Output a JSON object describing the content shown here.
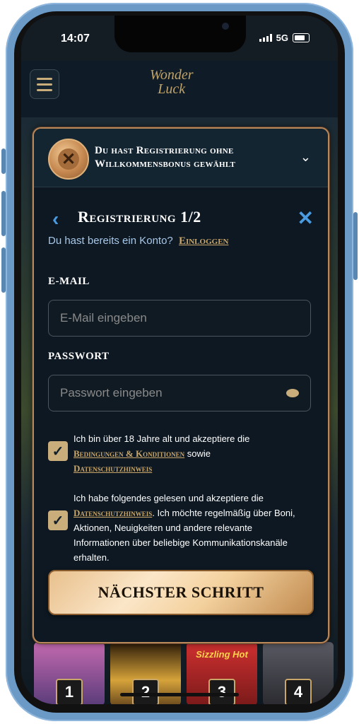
{
  "status_bar": {
    "time": "14:07",
    "network": "5G"
  },
  "site": {
    "logo_line1": "Wonder",
    "logo_line2": "Luck"
  },
  "bonus_banner": {
    "text": "Du hast Registrierung ohne Willkommensbonus gewählt",
    "icon": "x-coin-icon"
  },
  "registration": {
    "title": "Registrierung 1/2",
    "have_account_text": "Du hast bereits ein Konto?",
    "login_link": "Einloggen",
    "email_label": "E-MAIL",
    "email_placeholder": "E-Mail eingeben",
    "password_label": "PASSWORT",
    "password_placeholder": "Passwort eingeben",
    "checkbox1": {
      "checked": true,
      "text_before": "Ich bin über 18 Jahre alt und akzeptiere die",
      "link1": "Bedingungen & Konditionen",
      "text_mid": "sowie",
      "link2": "Datenschutzhinweis"
    },
    "checkbox2": {
      "checked": true,
      "text_before": "Ich habe folgendes gelesen und akzeptiere die",
      "link": "Datenschutzhinweis",
      "text_after": ". Ich möchte regelmäßig über Boni, Aktionen, Neuigkeiten und andere relevante Informationen über beliebige Kommunikationskanäle erhalten."
    },
    "next_button": "NÄCHSTER SCHRITT"
  },
  "games": [
    {
      "num": "1",
      "color": "#5a3c7a"
    },
    {
      "num": "2",
      "color": "#6b4a1e"
    },
    {
      "num": "3",
      "color": "#7a1a1a"
    },
    {
      "num": "4",
      "color": "#3a3a40"
    }
  ],
  "game_tile_label": "Sizzling Hot",
  "colors": {
    "accent": "#c9a66a",
    "link_blue": "#4a9be0",
    "modal_bg": "#0d1822"
  }
}
